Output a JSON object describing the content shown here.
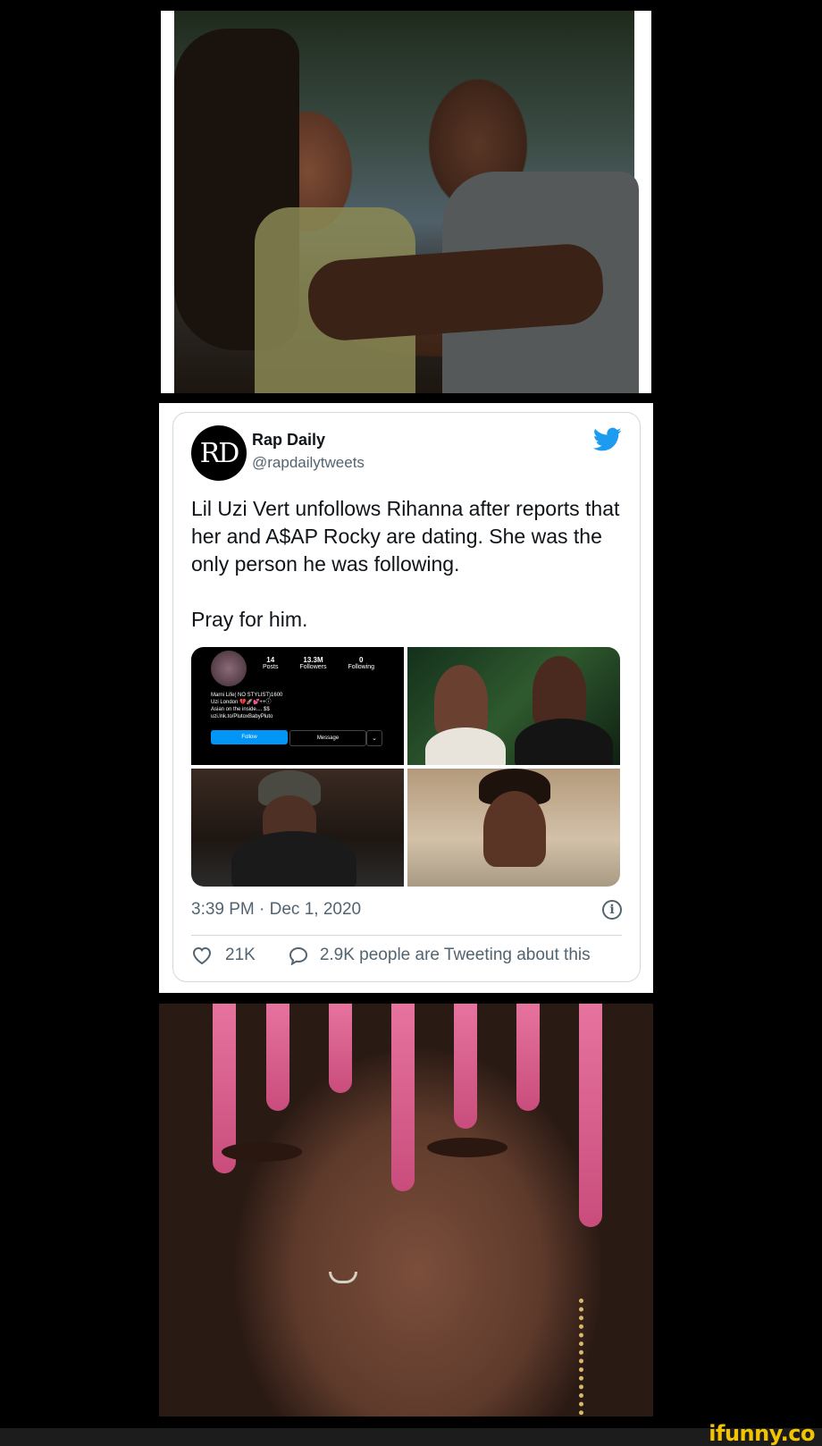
{
  "tweet": {
    "avatar_text": "RD",
    "display_name": "Rap Daily",
    "handle": "@rapdailytweets",
    "body": "Lil Uzi Vert unfollows Rihanna after reports that her and A$AP Rocky are dating. She was the only person he was following.\n\nPray for him.",
    "timestamp": "3:39 PM · Dec 1, 2020",
    "likes": "21K",
    "replies_text": "2.9K people are Tweeting about this",
    "info_glyph": "i"
  },
  "instagram_profile": {
    "posts_count": "14",
    "posts_label": "Posts",
    "followers_count": "13.3M",
    "followers_label": "Followers",
    "following_count": "0",
    "following_label": "Following",
    "bio": "Marni Life( NO STYLIST)1600\nUzi London 💔🚀💕++ⓘ\nAsian on the inside.... $$\nuzi.lnk.to/PlutoxBabyPluto",
    "follow_label": "Follow",
    "message_label": "Message",
    "more_glyph": "⌄"
  },
  "watermark": "ifunny.co",
  "colors": {
    "twitter_blue": "#1d9bf0",
    "instagram_blue": "#0095f6",
    "watermark_yellow": "#f2c400"
  },
  "icons": [
    "twitter-bird-icon",
    "heart-icon",
    "reply-icon",
    "info-icon"
  ]
}
